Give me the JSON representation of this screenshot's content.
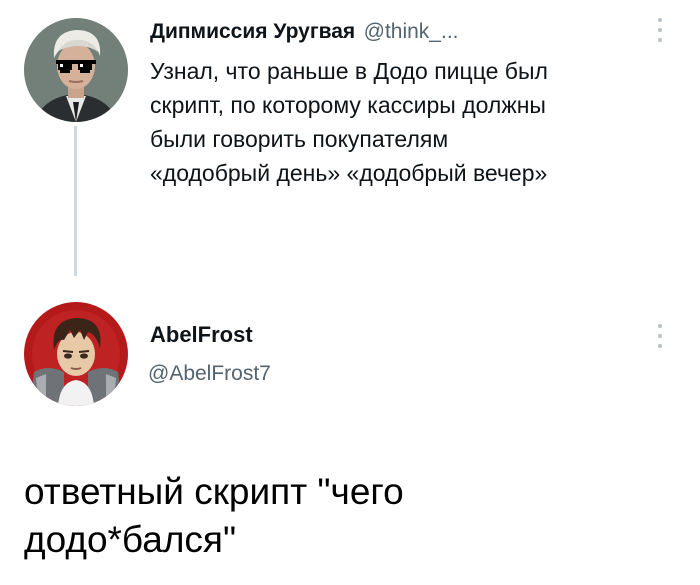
{
  "tweets": [
    {
      "display_name": "Дипмиссия Уругвая",
      "handle": "@think_...",
      "text_lines": [
        "Узнал, что раньше в Додо пицце был",
        "скрипт, по которому кассиры должны",
        "были говорить покупателям",
        "«додобрый день» «додобрый вечер»"
      ],
      "avatar_icon": "person-with-pixel-sunglasses"
    },
    {
      "display_name": "AbelFrost",
      "handle": "@AbelFrost7",
      "avatar_icon": "anime-character"
    }
  ],
  "caption_lines": [
    "ответный скрипт \"чего",
    "додо*бался\""
  ],
  "colors": {
    "name": "#0f1419",
    "handle": "#536471",
    "thread_line": "#cfd9de",
    "avatar1_bg": "#7a8a80",
    "avatar2_bg": "#b01818"
  }
}
